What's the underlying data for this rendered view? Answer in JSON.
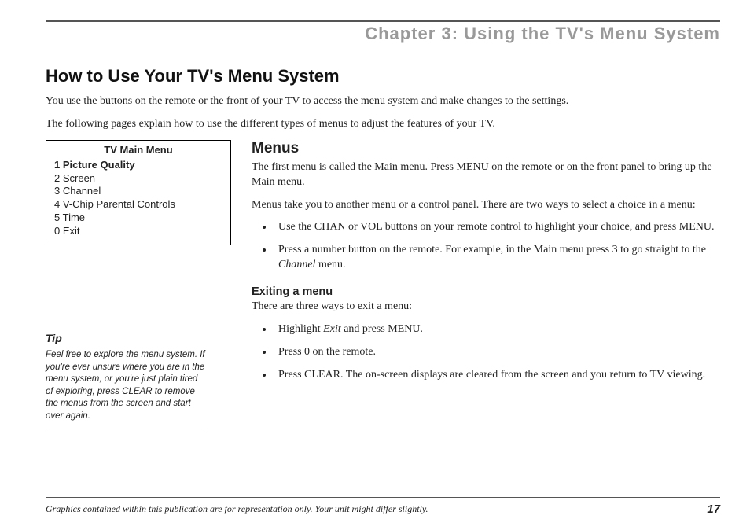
{
  "header": {
    "chapter_title": "Chapter 3: Using the TV's Menu System"
  },
  "main": {
    "title": "How to Use Your TV's Menu System",
    "intro_p1": "You use the buttons on the remote or the front of your TV to access the menu system and make changes to the settings.",
    "intro_p2": "The following pages explain how to use the different types of menus to adjust the features of your TV."
  },
  "menu_box": {
    "title": "TV Main Menu",
    "items": [
      {
        "num": "1",
        "label": "Picture Quality",
        "selected": true
      },
      {
        "num": "2",
        "label": "Screen",
        "selected": false
      },
      {
        "num": "3",
        "label": "Channel",
        "selected": false
      },
      {
        "num": "4",
        "label": "V-Chip Parental Controls",
        "selected": false
      },
      {
        "num": "5",
        "label": "Time",
        "selected": false
      },
      {
        "num": "0",
        "label": "Exit",
        "selected": false
      }
    ]
  },
  "tip": {
    "heading": "Tip",
    "text": "Feel free to explore the menu system. If you're ever unsure where you are in the menu system, or you're just plain tired of exploring, press CLEAR to remove the menus from the screen and start over again."
  },
  "menus_section": {
    "heading": "Menus",
    "p1": "The first menu is called the Main menu. Press MENU on the remote or on the front panel to bring up the Main menu.",
    "p2": "Menus take you to another menu or a control panel. There are two ways to select a choice in a menu:",
    "b1": "Use the CHAN or VOL buttons on your remote control to highlight your choice, and press MENU.",
    "b2_pre": "Press a number button on the remote. For example, in the Main menu press 3 to go straight to the ",
    "b2_ital": "Channel",
    "b2_post": " menu.",
    "exit_heading": "Exiting a menu",
    "exit_p": "There are three ways to exit a menu:",
    "e1_pre": "Highlight ",
    "e1_ital": "Exit",
    "e1_post": " and press MENU.",
    "e2": "Press 0 on the remote.",
    "e3": "Press CLEAR. The on-screen displays are cleared from the screen and you return to TV viewing."
  },
  "footer": {
    "text": "Graphics contained within this publication are for representation only. Your unit might differ slightly.",
    "page": "17"
  }
}
